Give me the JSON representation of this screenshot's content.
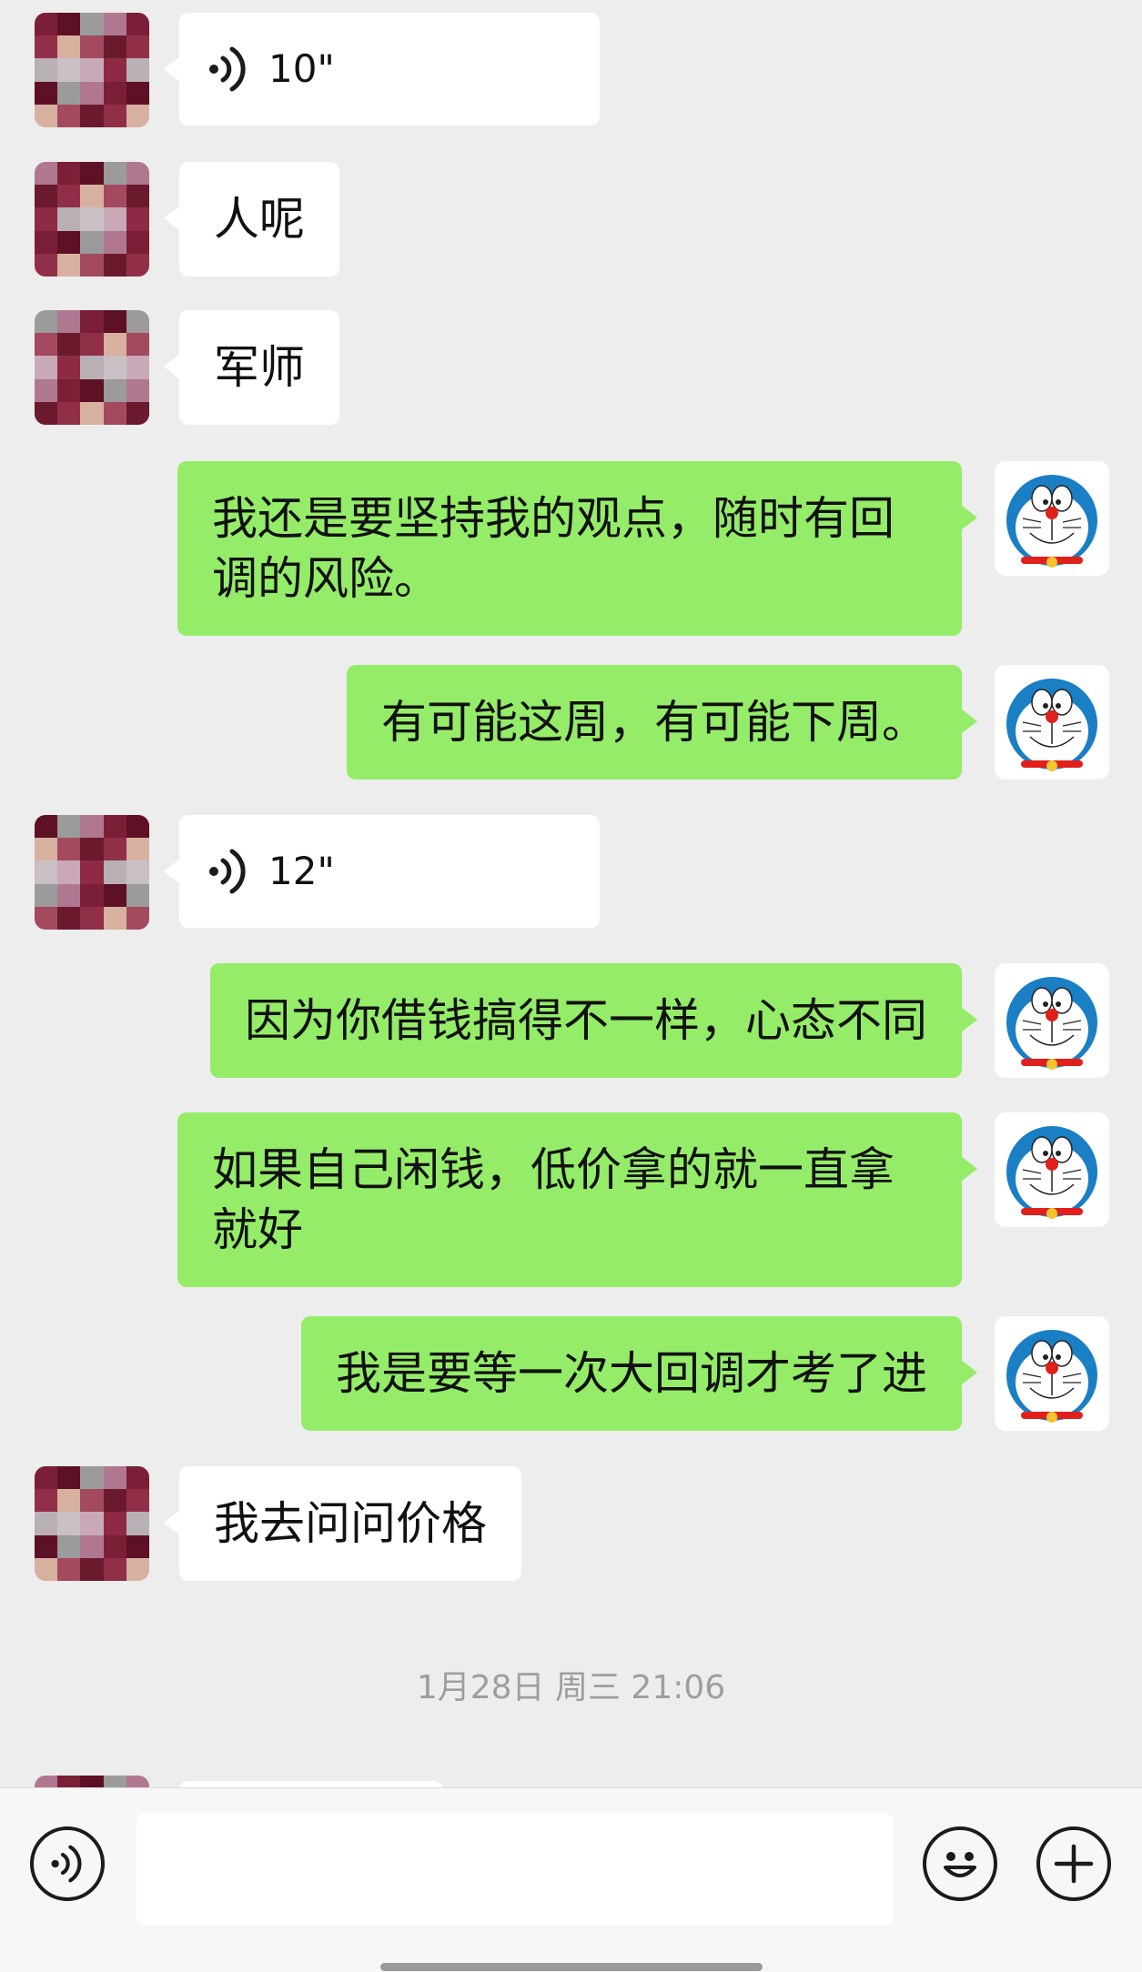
{
  "messages": [
    {
      "side": "other",
      "type": "voice",
      "duration": "10\""
    },
    {
      "side": "other",
      "type": "text",
      "text": "人呢"
    },
    {
      "side": "other",
      "type": "text",
      "text": "军师"
    },
    {
      "side": "mine",
      "type": "text",
      "text": "我还是要坚持我的观点，随时有回调的风险。"
    },
    {
      "side": "mine",
      "type": "text",
      "text": "有可能这周，有可能下周。"
    },
    {
      "side": "other",
      "type": "voice",
      "duration": "12\""
    },
    {
      "side": "mine",
      "type": "text",
      "text": "因为你借钱搞得不一样，心态不同"
    },
    {
      "side": "mine",
      "type": "text",
      "text": "如果自己闲钱，低价拿的就一直拿就好"
    },
    {
      "side": "mine",
      "type": "text",
      "text": "我是要等一次大回调才考了进"
    },
    {
      "side": "other",
      "type": "text",
      "text": "我去问问价格"
    }
  ],
  "timestamp": "1月28日 周三 21:06",
  "input_bar": {
    "voice_button_icon": "voice-icon",
    "text_value": "",
    "emoji_button_icon": "emoji-icon",
    "more_button_icon": "plus-icon"
  },
  "colors": {
    "background": "#ededed",
    "my_bubble": "#95ec69",
    "other_bubble": "#ffffff",
    "timestamp": "#9e9e9e"
  },
  "avatars": {
    "other": "pixelated-avatar",
    "mine": "doraemon-avatar"
  }
}
